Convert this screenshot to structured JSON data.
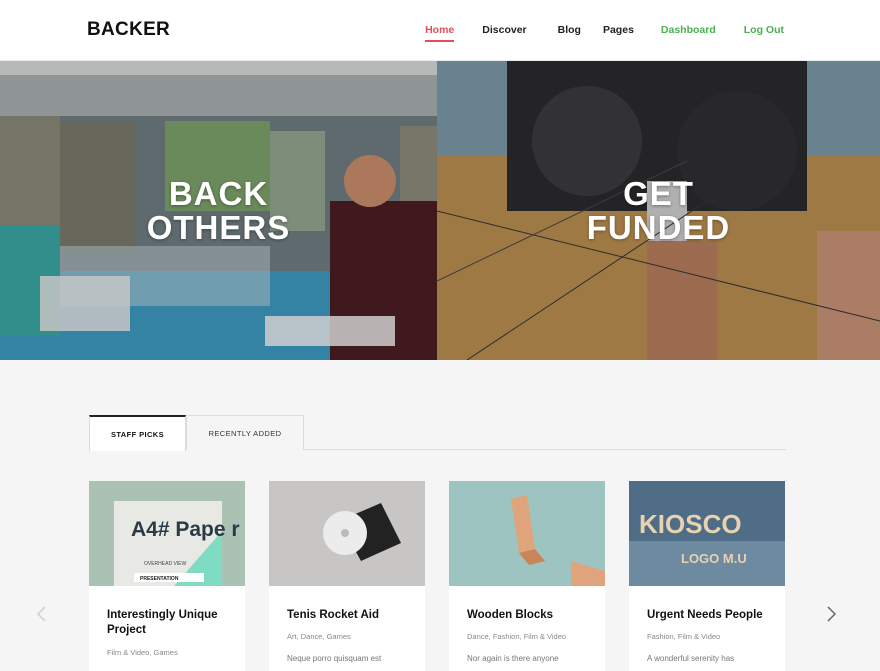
{
  "header": {
    "logo": "BACKER",
    "nav": [
      {
        "label": "Home"
      },
      {
        "label": "Discover"
      },
      {
        "label": "Blog"
      },
      {
        "label": "Pages"
      },
      {
        "label": "Dashboard"
      },
      {
        "label": "Log Out"
      }
    ]
  },
  "hero": {
    "left_line1": "BACK",
    "left_line2": "OTHERS",
    "right_line1": "GET",
    "right_line2": "FUNDED"
  },
  "tabs": {
    "active": "STAFF PICKS",
    "inactive": "RECENTLY ADDED"
  },
  "cards": [
    {
      "title": "Interestingly Unique Project",
      "categories": "Film & Video, Games",
      "description": "",
      "thumb_text": "A4# Pape r",
      "thumb_caption": "PRESENTATION",
      "thumb_small": "OVERHEAD VIEW"
    },
    {
      "title": "Tenis Rocket Aid",
      "categories": "Art, Dance, Games",
      "description": "Neque porro quisquam est"
    },
    {
      "title": "Wooden Blocks",
      "categories": "Dance, Fashion, Film & Video",
      "description": "Nor again is there anyone"
    },
    {
      "title": "Urgent Needs People",
      "categories": "Fashion, Film & Video",
      "description": "A wonderful serenity has",
      "thumb_text": "KIOSCO",
      "thumb_sub": "LOGO M.U"
    }
  ],
  "colors": {
    "accent_home": "#e0505a",
    "accent_green": "#4caf50"
  }
}
